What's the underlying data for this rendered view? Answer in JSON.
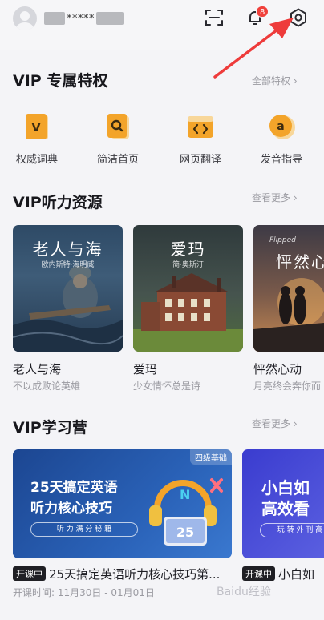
{
  "header": {
    "user_name_mask": "*****",
    "notification_count": "8",
    "icons": [
      "avatar",
      "scan-icon",
      "bell-icon",
      "settings-icon"
    ]
  },
  "vip_privileges": {
    "title": "VIP 专属特权",
    "more": "全部特权 ›",
    "items": [
      {
        "label": "权威词典",
        "icon": "dictionary-icon",
        "glyph": "V"
      },
      {
        "label": "简洁首页",
        "icon": "search-home-icon",
        "glyph": "Q"
      },
      {
        "label": "网页翻译",
        "icon": "web-translate-icon",
        "glyph": "<>"
      },
      {
        "label": "发音指导",
        "icon": "pronunciation-icon",
        "glyph": "a"
      }
    ]
  },
  "listening": {
    "title": "VIP听力资源",
    "more": "查看更多 ›",
    "cards": [
      {
        "title": "老人与海",
        "subtitle": "不以成败论英雄",
        "cover_title": "老人与海",
        "cover_author": "欧内斯特·海明威"
      },
      {
        "title": "爱玛",
        "subtitle": "少女情怀总是诗",
        "cover_title": "爱玛",
        "cover_author": "简·奥斯汀"
      },
      {
        "title": "怦然心动",
        "subtitle": "月亮终会奔你而",
        "cover_title": "怦然心",
        "cover_author": "Flipped"
      }
    ]
  },
  "camp": {
    "title": "VIP学习营",
    "more": "查看更多 ›",
    "cards": [
      {
        "tag": "开课中",
        "title": "25天搞定英语听力核心技巧第...",
        "badge": "四级基础",
        "cover_line1": "25天搞定英语",
        "cover_line2": "听力核心技巧",
        "cover_sub": "听 力 满 分 秘 籍",
        "time": "开课时间: 11月30日 - 01月01日"
      },
      {
        "tag": "开课中",
        "title": "小白如",
        "cover_line1": "小白如",
        "cover_line2": "高效看",
        "cover_sub": "玩 转 外 刊 高"
      }
    ]
  },
  "watermark": "Baidu经验",
  "colors": {
    "accent_orange": "#f3a42a",
    "badge_red": "#f0403b",
    "arrow_red": "#ee3b3b",
    "camp_blue": "#1f4f9c"
  }
}
